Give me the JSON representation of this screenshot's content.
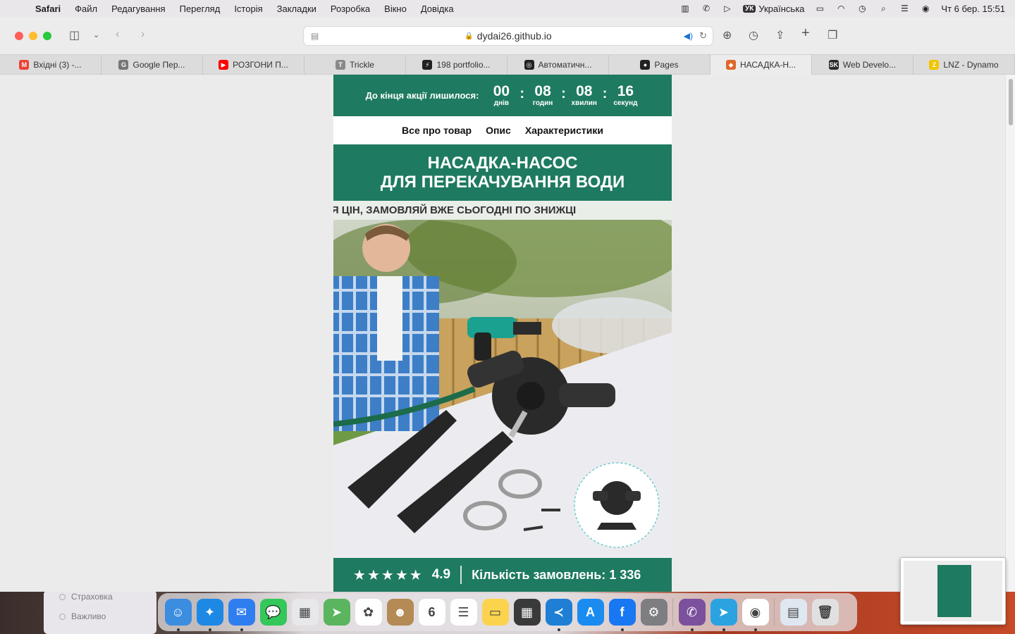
{
  "menubar": {
    "app": "Safari",
    "items": [
      "Файл",
      "Редагування",
      "Перегляд",
      "Історія",
      "Закладки",
      "Розробка",
      "Вікно",
      "Довідка"
    ],
    "input_badge": "УК",
    "input_source": "Українська",
    "clock": "Чт 6 бер.  15:51"
  },
  "browser": {
    "url": "dydai26.github.io",
    "tabs": [
      {
        "label": "Вхідні (3) -...",
        "icon": "gmail-icon",
        "color": "#ea4335",
        "glyph": "M"
      },
      {
        "label": "Google Пер...",
        "icon": "google-translate-icon",
        "color": "#777777",
        "glyph": "G"
      },
      {
        "label": "РОЗГОНИ П...",
        "icon": "youtube-icon",
        "color": "#ff0000",
        "glyph": "▶"
      },
      {
        "label": "Trickle",
        "icon": "trickle-icon",
        "color": "#8a8a8a",
        "glyph": "T"
      },
      {
        "label": "198 portfolio...",
        "icon": "bolt-icon",
        "color": "#222222",
        "glyph": "⚡"
      },
      {
        "label": "Автоматичн...",
        "icon": "openai-icon",
        "color": "#222222",
        "glyph": "◎"
      },
      {
        "label": "Pages",
        "icon": "github-icon",
        "color": "#222222",
        "glyph": "●"
      },
      {
        "label": "НАСАДКА-Н...",
        "icon": "site-icon",
        "color": "#e0662a",
        "glyph": "◆"
      },
      {
        "label": "Web Develo...",
        "icon": "sk-icon",
        "color": "#2b2b2b",
        "glyph": "SK"
      },
      {
        "label": "LNZ - Dynamo",
        "icon": "lnz-icon",
        "color": "#f2c500",
        "glyph": "Z"
      }
    ],
    "active_tab": 7
  },
  "landing": {
    "timer": {
      "label": "До кінця акції лишилося:",
      "days": "00",
      "days_label": "днів",
      "hours": "08",
      "hours_label": "годин",
      "minutes": "08",
      "minutes_label": "хвилин",
      "seconds": "16",
      "seconds_label": "секунд"
    },
    "nav": [
      "Все про товар",
      "Опис",
      "Характеристики"
    ],
    "title_line1": "НАСАДКА-НАСОС",
    "title_line2": "ДЛЯ ПЕРЕКАЧУВАННЯ ВОДИ",
    "ticker": "НЯ ЦІН, ЗАМОВЛЯЙ ВЖЕ СЬОГОДНІ ПО ЗНИЖЦІ",
    "rating": "4.9",
    "stars": 5,
    "orders": "Кількість замовлень: 1 336"
  },
  "desktop_notes": [
    "Страховка",
    "Важливо"
  ],
  "dock": [
    {
      "name": "finder",
      "color": "#3b8de0",
      "glyph": "☺",
      "running": true
    },
    {
      "name": "safari",
      "color": "#1e88e5",
      "glyph": "✦",
      "running": true
    },
    {
      "name": "mail",
      "color": "#2f7ef0",
      "glyph": "✉",
      "running": true
    },
    {
      "name": "messages",
      "color": "#34c759",
      "glyph": "💬",
      "running": false
    },
    {
      "name": "launchpad",
      "color": "#e8e8ea",
      "glyph": "▦",
      "running": false
    },
    {
      "name": "maps",
      "color": "#5ab55e",
      "glyph": "➤",
      "running": false
    },
    {
      "name": "photos",
      "color": "#ffffff",
      "glyph": "✿",
      "running": false
    },
    {
      "name": "contacts",
      "color": "#b48a55",
      "glyph": "☻",
      "running": false
    },
    {
      "name": "calendar",
      "color": "#ffffff",
      "glyph": "6",
      "running": false
    },
    {
      "name": "reminders",
      "color": "#ffffff",
      "glyph": "☰",
      "running": false
    },
    {
      "name": "notes",
      "color": "#fcd34d",
      "glyph": "▭",
      "running": false
    },
    {
      "name": "calculator",
      "color": "#3a3a3a",
      "glyph": "▦",
      "running": false
    },
    {
      "name": "vscode",
      "color": "#1f7fd4",
      "glyph": "≺",
      "running": true
    },
    {
      "name": "app-store",
      "color": "#1a8cf0",
      "glyph": "A",
      "running": false
    },
    {
      "name": "facebook",
      "color": "#1877f2",
      "glyph": "f",
      "running": true
    },
    {
      "name": "system-settings",
      "color": "#7d7d82",
      "glyph": "⚙",
      "running": false
    },
    {
      "name": "viber",
      "color": "#7b519d",
      "glyph": "✆",
      "running": true
    },
    {
      "name": "telegram",
      "color": "#2aa3e0",
      "glyph": "➤",
      "running": true
    },
    {
      "name": "chrome",
      "color": "#ffffff",
      "glyph": "◉",
      "running": true
    },
    {
      "name": "downloads-folder",
      "color": "#dfe7f0",
      "glyph": "▤",
      "running": false
    },
    {
      "name": "trash",
      "color": "#e0e0e0",
      "glyph": "🗑",
      "running": false
    }
  ],
  "colors": {
    "brand_green": "#1e7a60",
    "accent_blue": "#1a6fd6"
  }
}
